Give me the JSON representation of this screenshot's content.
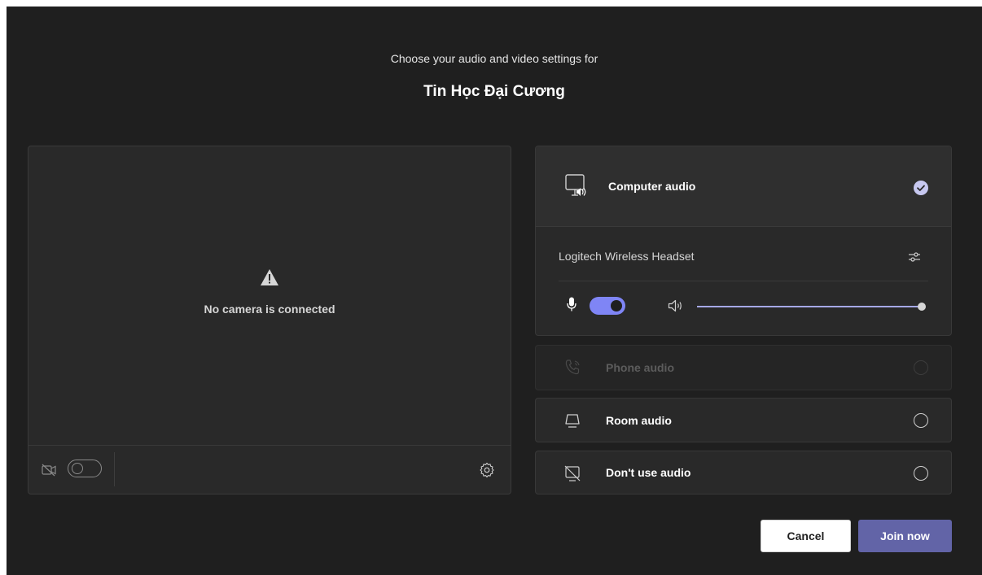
{
  "header": {
    "subtitle": "Choose your audio and video settings for",
    "meeting_title": "Tin Học Đại Cương"
  },
  "video": {
    "status_text": "No camera is connected",
    "camera_enabled": false
  },
  "audio": {
    "computer": {
      "label": "Computer audio",
      "selected": true,
      "device_name": "Logitech Wireless Headset",
      "mic_enabled": true,
      "volume_fraction": 1.0
    },
    "phone": {
      "label": "Phone audio",
      "disabled": true
    },
    "room": {
      "label": "Room audio",
      "selected": false
    },
    "none": {
      "label": "Don't use audio",
      "selected": false
    }
  },
  "actions": {
    "cancel_label": "Cancel",
    "join_label": "Join now"
  },
  "colors": {
    "accent": "#7f85f5",
    "primary_button": "#6264a7",
    "background": "#1f1f1f",
    "panel": "#292929"
  }
}
